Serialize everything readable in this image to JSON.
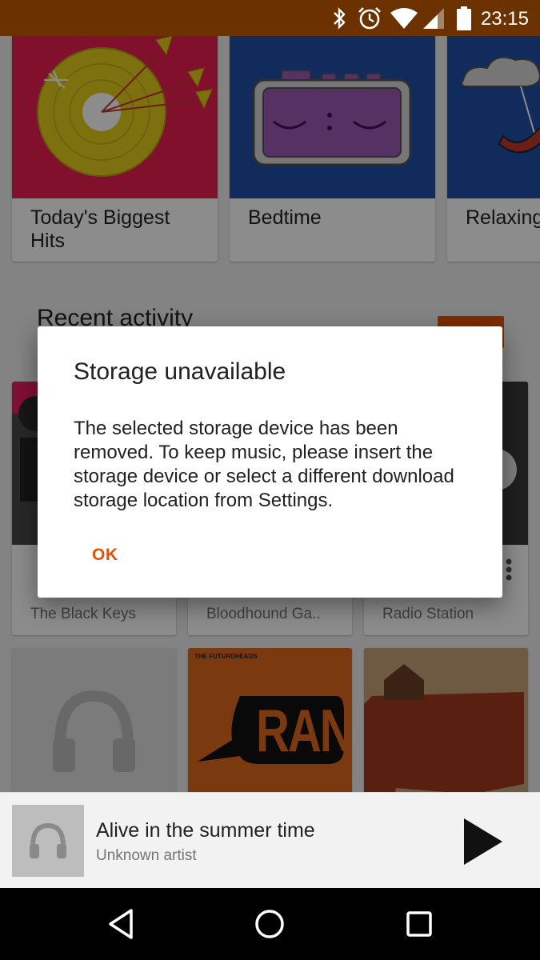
{
  "status_bar": {
    "time": "23:15",
    "icons": [
      "bluetooth-icon",
      "alarm-icon",
      "wifi-icon",
      "signal-icon",
      "battery-icon"
    ],
    "background_color": "#6b3200"
  },
  "playlists": [
    {
      "title": "Today's Biggest Hits",
      "art_color": "#e91e4f"
    },
    {
      "title": "Bedtime",
      "art_color": "#1e4fa8"
    },
    {
      "title": "Relaxing at Home",
      "art_color": "#1e4fa8"
    }
  ],
  "recent_activity": {
    "title": "Recent activity",
    "items": [
      {
        "subtitle": "The Black Keys"
      },
      {
        "subtitle": "Bloodhound Ga.."
      },
      {
        "subtitle": "Radio Station"
      }
    ],
    "albums": [
      {
        "label": "",
        "icon": "headphones-icon"
      },
      {
        "label": "THE FUTUREHEADS",
        "art_text": "RANT"
      },
      {
        "label": "",
        "icon": "bear-cabin-art"
      }
    ]
  },
  "dialog": {
    "title": "Storage unavailable",
    "body": "The selected storage device has been removed. To keep music, please insert the storage device or select a different download storage location from Settings.",
    "ok_label": "OK"
  },
  "now_playing": {
    "title": "Alive in the summer time",
    "artist": "Unknown artist"
  },
  "nav_bar": {
    "buttons": [
      "back-icon",
      "home-icon",
      "recents-icon"
    ]
  },
  "colors": {
    "accent": "#e65100",
    "scrim": "rgba(0,0,0,0.45)"
  }
}
